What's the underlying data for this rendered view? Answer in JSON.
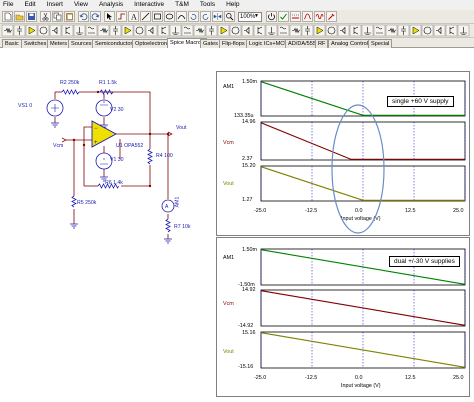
{
  "menu": [
    "File",
    "Edit",
    "Insert",
    "View",
    "Analysis",
    "Interactive",
    "T&M",
    "Tools",
    "Help"
  ],
  "toolbar": {
    "zoom": "100%"
  },
  "tabs": [
    "Basic",
    "Switches",
    "Meters",
    "Sources",
    "Semiconductors",
    "Optoelectronic",
    "Spice Macros",
    "Gates",
    "Flip-flops",
    "Logic ICs+MCUs",
    "AD/DA/555",
    "RF",
    "Analog Control",
    "Special"
  ],
  "active_tab": "Spice Macros",
  "schematic": {
    "vs1": "VS1 0",
    "r2": "R2 250k",
    "r1": "R1 1.5k",
    "v2": "V2 30",
    "v1": "V1 30",
    "opamp": "U1 OPA552",
    "vm": "Vcm",
    "vout": "Vout",
    "r4": "R4 100",
    "r6": "R6 1.4k",
    "r5": "R5 250k",
    "r7": "R7 10k",
    "am1": "AM1",
    "am1_rot": "AM1",
    "small_pin": "+",
    "mini_label": "V2"
  },
  "plot1": {
    "note": "single +60 V supply",
    "xlabel": "Input voltage (V)",
    "xticks": [
      "-25.0",
      "-12.5",
      "0.0",
      "12.5",
      "25.0"
    ],
    "traces": [
      {
        "name": "AM1",
        "top": "1.50m",
        "bottom": "133.35u",
        "color": "#008000"
      },
      {
        "name": "Vcm",
        "top": "14.96",
        "bottom": "2.37",
        "color": "#800000"
      },
      {
        "name": "Vout",
        "top": "15.20",
        "bottom": "1.27",
        "color": "#808000"
      }
    ]
  },
  "plot2": {
    "note": "dual +/-30 V supplies",
    "xlabel": "Input voltage (V)",
    "xticks": [
      "-25.0",
      "-12.5",
      "0.0",
      "12.5",
      "25.0"
    ],
    "traces": [
      {
        "name": "AM1",
        "top": "1.50m",
        "bottom": "-1.50m",
        "color": "#008000"
      },
      {
        "name": "Vcm",
        "top": "14.92",
        "bottom": "-14.92",
        "color": "#800000"
      },
      {
        "name": "Vout",
        "top": "15.16",
        "bottom": "-15.16",
        "color": "#808000"
      }
    ]
  },
  "colors": {
    "wire": "#800000",
    "component": "#1a1ab0",
    "opamp": "#f0e000",
    "highlight": "#6a8cc8"
  }
}
